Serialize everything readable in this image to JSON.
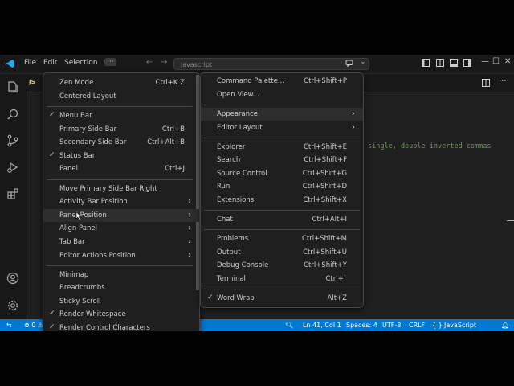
{
  "titlebar": {
    "menus": [
      "File",
      "Edit",
      "Selection"
    ],
    "more": "···",
    "search_placeholder": "javascript"
  },
  "tab": {
    "icon_label": "JS"
  },
  "editor": {
    "visible_code": "single, double inverted commas"
  },
  "left_menu": {
    "items": [
      {
        "label": "Zen Mode",
        "key": "Ctrl+K Z",
        "checked": false,
        "submenu": false
      },
      {
        "label": "Centered Layout",
        "key": "",
        "checked": false,
        "submenu": false
      },
      {
        "label": "Menu Bar",
        "key": "",
        "checked": true,
        "submenu": false
      },
      {
        "label": "Primary Side Bar",
        "key": "Ctrl+B",
        "checked": false,
        "submenu": false
      },
      {
        "label": "Secondary Side Bar",
        "key": "Ctrl+Alt+B",
        "checked": false,
        "submenu": false
      },
      {
        "label": "Status Bar",
        "key": "",
        "checked": true,
        "submenu": false
      },
      {
        "label": "Panel",
        "key": "Ctrl+J",
        "checked": false,
        "submenu": false
      },
      {
        "label": "Move Primary Side Bar Right",
        "key": "",
        "checked": false,
        "submenu": false
      },
      {
        "label": "Activity Bar Position",
        "key": "",
        "checked": false,
        "submenu": true
      },
      {
        "label": "Panel Position",
        "key": "",
        "checked": false,
        "submenu": true
      },
      {
        "label": "Align Panel",
        "key": "",
        "checked": false,
        "submenu": true
      },
      {
        "label": "Tab Bar",
        "key": "",
        "checked": false,
        "submenu": true
      },
      {
        "label": "Editor Actions Position",
        "key": "",
        "checked": false,
        "submenu": true
      },
      {
        "label": "Minimap",
        "key": "",
        "checked": false,
        "submenu": false
      },
      {
        "label": "Breadcrumbs",
        "key": "",
        "checked": false,
        "submenu": false
      },
      {
        "label": "Sticky Scroll",
        "key": "",
        "checked": false,
        "submenu": false
      },
      {
        "label": "Render Whitespace",
        "key": "",
        "checked": true,
        "submenu": false
      },
      {
        "label": "Render Control Characters",
        "key": "",
        "checked": true,
        "submenu": false
      }
    ]
  },
  "right_menu": {
    "items": [
      {
        "label": "Command Palette...",
        "key": "Ctrl+Shift+P",
        "checked": false,
        "submenu": false
      },
      {
        "label": "Open View...",
        "key": "",
        "checked": false,
        "submenu": false
      },
      {
        "label": "Appearance",
        "key": "",
        "checked": false,
        "submenu": true
      },
      {
        "label": "Editor Layout",
        "key": "",
        "checked": false,
        "submenu": true
      },
      {
        "label": "Explorer",
        "key": "Ctrl+Shift+E",
        "checked": false,
        "submenu": false
      },
      {
        "label": "Search",
        "key": "Ctrl+Shift+F",
        "checked": false,
        "submenu": false
      },
      {
        "label": "Source Control",
        "key": "Ctrl+Shift+G",
        "checked": false,
        "submenu": false
      },
      {
        "label": "Run",
        "key": "Ctrl+Shift+D",
        "checked": false,
        "submenu": false
      },
      {
        "label": "Extensions",
        "key": "Ctrl+Shift+X",
        "checked": false,
        "submenu": false
      },
      {
        "label": "Chat",
        "key": "Ctrl+Alt+I",
        "checked": false,
        "submenu": false
      },
      {
        "label": "Problems",
        "key": "Ctrl+Shift+M",
        "checked": false,
        "submenu": false
      },
      {
        "label": "Output",
        "key": "Ctrl+Shift+U",
        "checked": false,
        "submenu": false
      },
      {
        "label": "Debug Console",
        "key": "Ctrl+Shift+Y",
        "checked": false,
        "submenu": false
      },
      {
        "label": "Terminal",
        "key": "Ctrl+`",
        "checked": false,
        "submenu": false
      },
      {
        "label": "Word Wrap",
        "key": "Alt+Z",
        "checked": true,
        "submenu": false
      }
    ]
  },
  "statusbar": {
    "errors": "0",
    "errors_trunc": "⊗ 0 ⚠",
    "position": "Ln 41, Col 1",
    "spaces": "Spaces: 4",
    "encoding": "UTF-8",
    "eol": "CRLF",
    "language_braces": "{ }",
    "language": "JavaScript"
  },
  "colors": {
    "accent": "#0078d4",
    "menu_bg": "#1f1f1f",
    "bg": "#1f1f1f"
  }
}
